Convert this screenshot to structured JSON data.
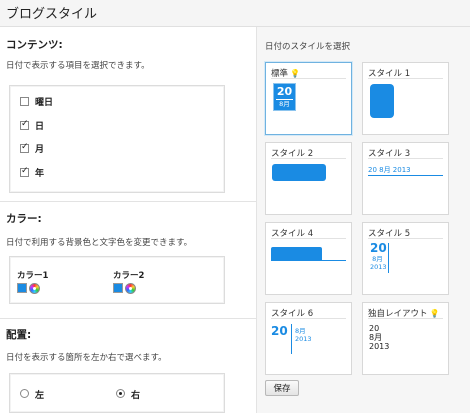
{
  "page": {
    "title": "ブログスタイル"
  },
  "contents": {
    "title": "コンテンツ:",
    "description": "日付で表示する項目を選択できます。",
    "items": [
      {
        "label": "曜日",
        "checked": false
      },
      {
        "label": "日",
        "checked": true
      },
      {
        "label": "月",
        "checked": true
      },
      {
        "label": "年",
        "checked": true
      }
    ]
  },
  "color": {
    "title": "カラー:",
    "description": "日付で利用する背景色と文字色を変更できます。",
    "color1_label": "カラー1",
    "color2_label": "カラー2",
    "color1_value": "#1a8be3",
    "color2_value": "#1a8be3"
  },
  "placement": {
    "title": "配置:",
    "description": "日付を表示する箇所を左か右で選べます。",
    "left_label": "左",
    "right_label": "右",
    "selected": "右"
  },
  "styles": {
    "title": "日付のスタイルを選択",
    "selected": "標準",
    "accent_color": "#1a8be3",
    "cards": [
      {
        "name": "標準"
      },
      {
        "name": "スタイル 1"
      },
      {
        "name": "スタイル 2"
      },
      {
        "name": "スタイル 3",
        "text": "20 8月 2013"
      },
      {
        "name": "スタイル 4"
      },
      {
        "name": "スタイル 5",
        "day": "20",
        "month": "8月",
        "year": "2013"
      },
      {
        "name": "スタイル 6",
        "day": "20",
        "month": "8月",
        "year": "2013"
      },
      {
        "name": "独自レイアウト",
        "day": "20",
        "month": "8月",
        "year": "2013"
      }
    ],
    "standard_day": "20",
    "standard_month": "8月",
    "save_label": "保存"
  }
}
